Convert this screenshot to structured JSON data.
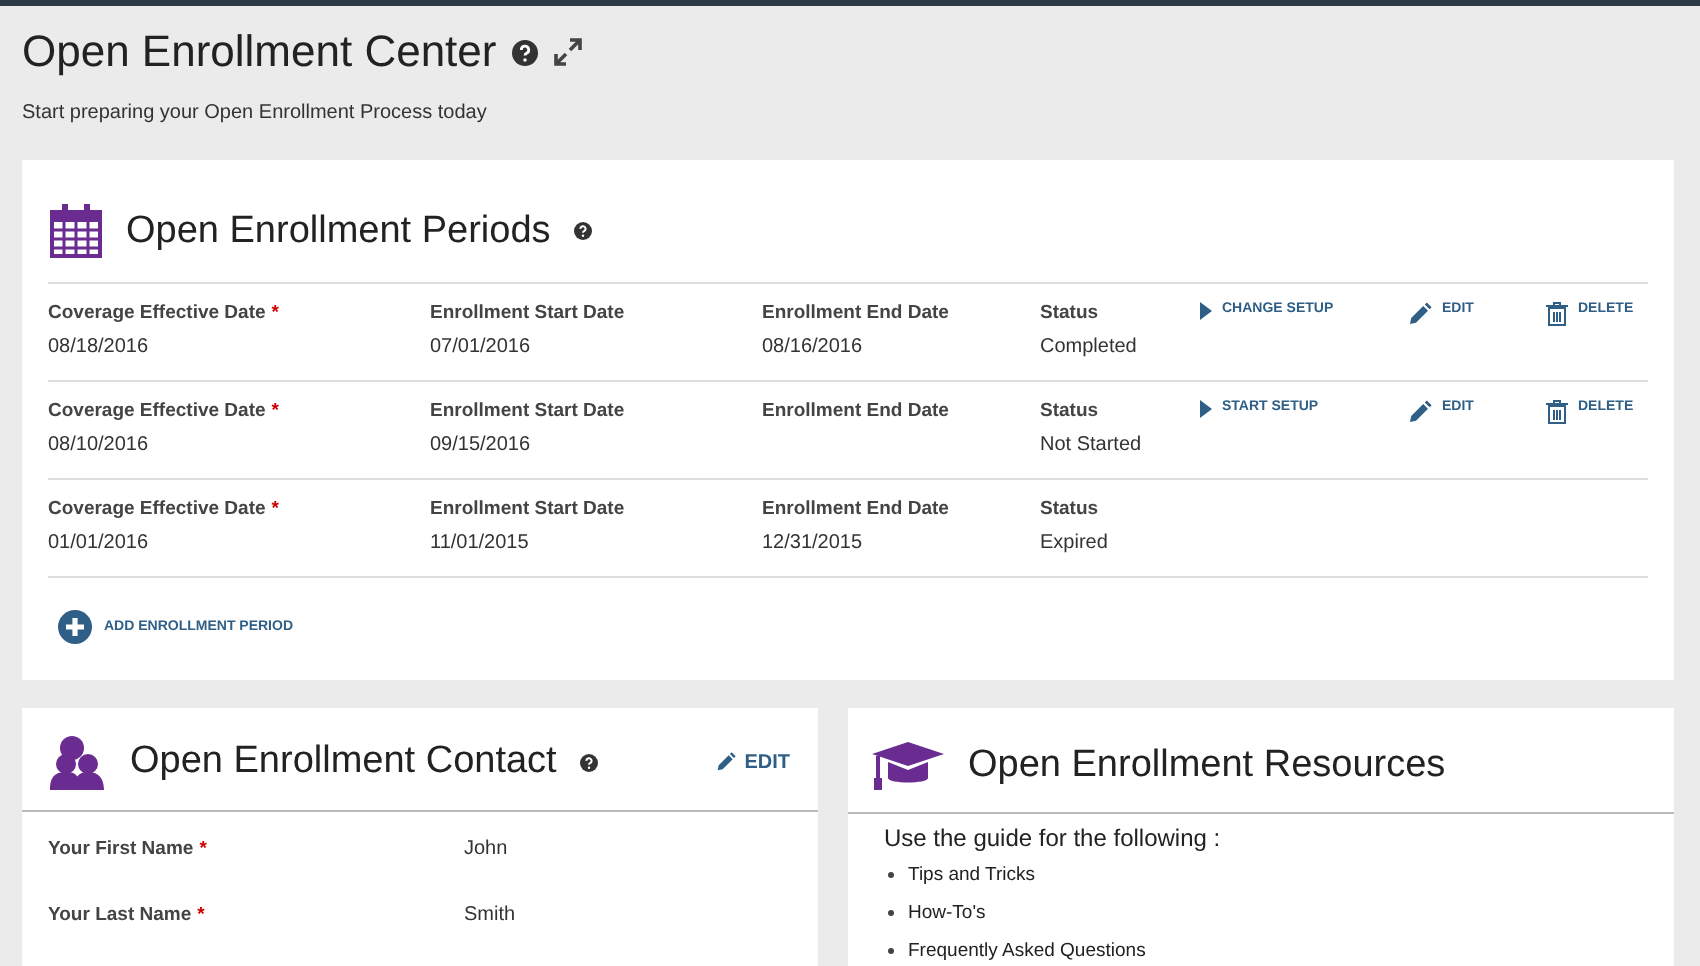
{
  "header": {
    "title": "Open Enrollment Center",
    "subtitle": "Start preparing your Open Enrollment Process today"
  },
  "periods": {
    "title": "Open Enrollment Periods",
    "rows": [
      {
        "fields": [
          {
            "label": "Coverage Effective Date",
            "required": "*",
            "value": "08/18/2016"
          },
          {
            "label": "Enrollment Start Date",
            "value": "07/01/2016"
          },
          {
            "label": "Enrollment End Date",
            "value": "08/16/2016"
          },
          {
            "label": "Status",
            "value": "Completed"
          }
        ],
        "actions": [
          {
            "kind": "setup",
            "label": "CHANGE SETUP"
          },
          {
            "kind": "edit",
            "label": "EDIT"
          },
          {
            "kind": "delete",
            "label": "DELETE"
          }
        ]
      },
      {
        "fields": [
          {
            "label": "Coverage Effective Date",
            "required": "*",
            "value": "08/10/2016"
          },
          {
            "label": "Enrollment Start Date",
            "value": "09/15/2016"
          },
          {
            "label": "Enrollment End Date"
          },
          {
            "label": "Status",
            "value": "Not Started"
          }
        ],
        "actions": [
          {
            "kind": "setup",
            "label": "START SETUP"
          },
          {
            "kind": "edit",
            "label": "EDIT"
          },
          {
            "kind": "delete",
            "label": "DELETE"
          }
        ]
      },
      {
        "fields": [
          {
            "label": "Coverage Effective Date",
            "required": "*",
            "value": "01/01/2016"
          },
          {
            "label": "Enrollment Start Date",
            "value": "11/01/2015"
          },
          {
            "label": "Enrollment End Date",
            "value": "12/31/2015"
          },
          {
            "label": "Status",
            "value": "Expired"
          }
        ],
        "actions": []
      }
    ],
    "add_button": "ADD ENROLLMENT PERIOD"
  },
  "contact": {
    "title": "Open Enrollment Contact",
    "edit": "EDIT",
    "fields": [
      {
        "label": "Your First Name",
        "required": "*",
        "value": "John"
      },
      {
        "label": "Your Last Name",
        "required": "*",
        "value": "Smith"
      }
    ]
  },
  "resources": {
    "title": "Open Enrollment Resources",
    "intro": "Use the guide for the following :",
    "items": [
      "Tips and Tricks",
      "How-To's",
      "Frequently Asked Questions"
    ]
  }
}
